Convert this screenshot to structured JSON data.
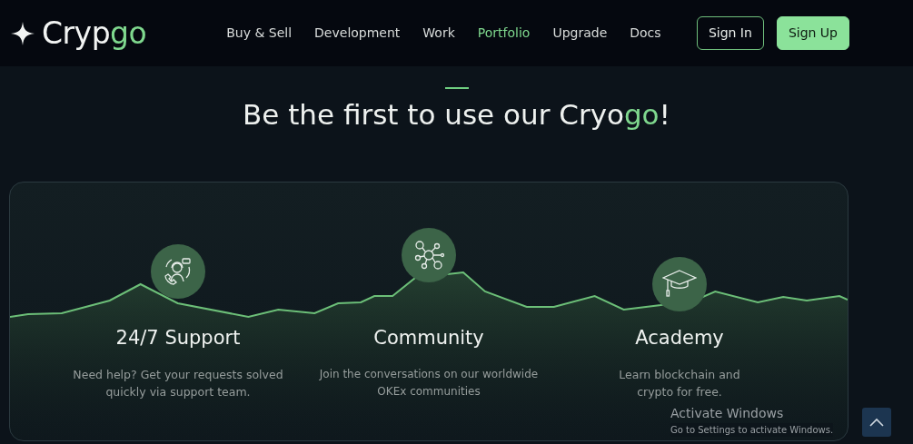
{
  "brand": {
    "text": "Cryp",
    "accent": "go"
  },
  "nav": [
    {
      "label": "Buy & Sell",
      "selected": false
    },
    {
      "label": "Development",
      "selected": false
    },
    {
      "label": "Work",
      "selected": false
    },
    {
      "label": "Portfolio",
      "selected": true
    },
    {
      "label": "Upgrade",
      "selected": false
    },
    {
      "label": "Docs",
      "selected": false
    }
  ],
  "auth_buttons": [
    {
      "label": "Sign In",
      "kind": "outline"
    },
    {
      "label": "Sign Up",
      "kind": "filled"
    }
  ],
  "heading": {
    "text": "Be the first to use our Cryo",
    "accent": "go",
    "end": "!"
  },
  "features": [
    {
      "title": "24/7 Support",
      "description": "Need help? Get your requests solved quickly via support team."
    },
    {
      "title": "Community",
      "description": "Join the conversations on our worldwide OKEx communities"
    },
    {
      "title": "Academy",
      "description": "Learn blockchain and crypto for free."
    }
  ],
  "os_notice": {
    "title": "Activate Windows",
    "subtitle": "Go to Settings to activate Windows."
  }
}
